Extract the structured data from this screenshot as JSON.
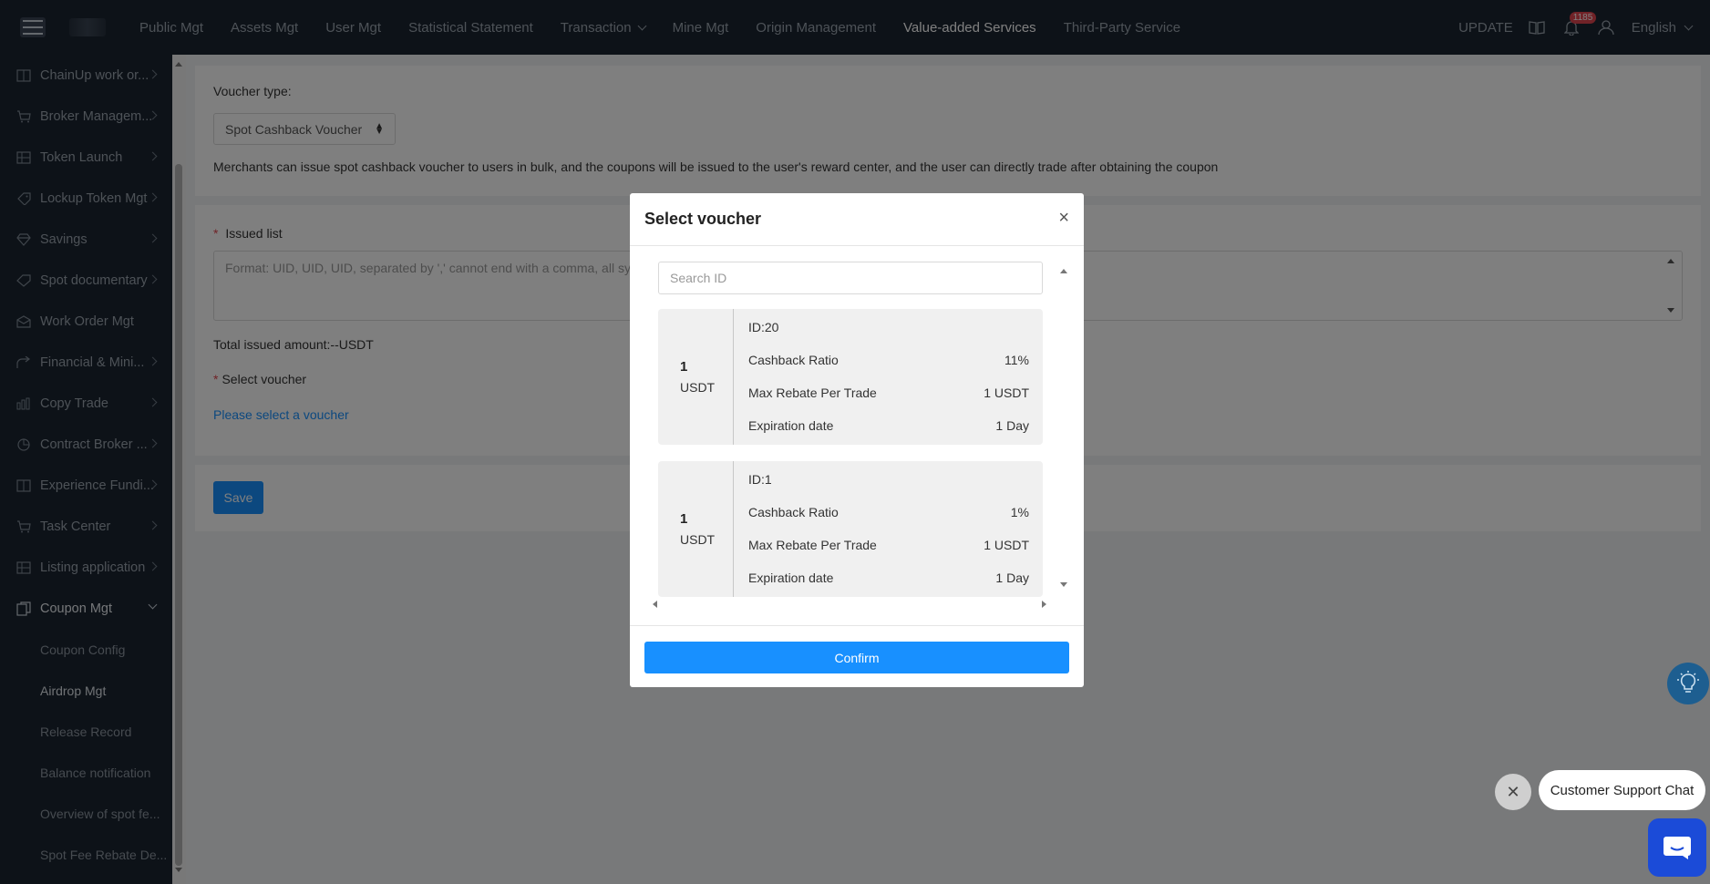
{
  "topbar": {
    "nav": [
      {
        "label": "Public Mgt"
      },
      {
        "label": "Assets Mgt"
      },
      {
        "label": "User Mgt"
      },
      {
        "label": "Statistical Statement"
      },
      {
        "label": "Transaction"
      },
      {
        "label": "Mine Mgt"
      },
      {
        "label": "Origin Management"
      },
      {
        "label": "Value-added Services"
      },
      {
        "label": "Third-Party Service"
      }
    ],
    "update_label": "UPDATE",
    "notification_count": "1185",
    "language": "English"
  },
  "sidebar": {
    "items": [
      {
        "label": "ChainUp work or...",
        "icon": "book-icon"
      },
      {
        "label": "Broker Managem...",
        "icon": "cart-icon"
      },
      {
        "label": "Token Launch",
        "icon": "grid-icon"
      },
      {
        "label": "Lockup Token Mgt",
        "icon": "lock-icon"
      },
      {
        "label": "Savings",
        "icon": "diamond-icon"
      },
      {
        "label": "Spot documentary",
        "icon": "tag-icon"
      },
      {
        "label": "Work Order Mgt",
        "icon": "envelope-icon"
      },
      {
        "label": "Financial & Mini...",
        "icon": "share-icon"
      },
      {
        "label": "Copy Trade",
        "icon": "bar-chart-icon"
      },
      {
        "label": "Contract Broker ...",
        "icon": "pie-icon"
      },
      {
        "label": "Experience Fundi...",
        "icon": "book-icon"
      },
      {
        "label": "Task Center",
        "icon": "cart-icon"
      },
      {
        "label": "Listing application",
        "icon": "grid-icon"
      },
      {
        "label": "Coupon Mgt",
        "icon": "coupon-icon"
      }
    ],
    "sub_items": [
      {
        "label": "Coupon Config"
      },
      {
        "label": "Airdrop Mgt"
      },
      {
        "label": "Release Record"
      },
      {
        "label": "Balance notification"
      },
      {
        "label": "Overview of spot fe..."
      },
      {
        "label": "Spot Fee Rebate De..."
      }
    ]
  },
  "form": {
    "voucher_type_label": "Voucher type:",
    "voucher_type_value": "Spot Cashback Voucher",
    "description": "Merchants can issue spot cashback voucher to users in bulk, and the coupons will be issued to the user's reward center, and the user can directly trade after obtaining the coupon",
    "issued_list_label": "Issued list",
    "issued_list_placeholder": "Format: UID, UID, UID, separated by ',' cannot end with a comma, all sym",
    "total_issued": "Total issued amount:--USDT",
    "select_voucher_label": "Select voucher",
    "select_voucher_link": "Please select a voucher",
    "save_label": "Save"
  },
  "modal": {
    "title": "Select voucher",
    "close_glyph": "×",
    "search_placeholder": "Search ID",
    "vouchers": [
      {
        "amount": "1",
        "currency": "USDT",
        "id": "ID:20",
        "ratio_label": "Cashback Ratio",
        "ratio": "11%",
        "max_label": "Max Rebate Per Trade",
        "max": "1 USDT",
        "exp_label": "Expiration date",
        "exp": "1 Day"
      },
      {
        "amount": "1",
        "currency": "USDT",
        "id": "ID:1",
        "ratio_label": "Cashback Ratio",
        "ratio": "1%",
        "max_label": "Max Rebate Per Trade",
        "max": "1 USDT",
        "exp_label": "Expiration date",
        "exp": "1 Day"
      }
    ],
    "confirm_label": "Confirm"
  },
  "chat": {
    "bubble_text": "Customer Support Chat",
    "close_glyph": "✕"
  },
  "colors": {
    "topbar_bg": "#1b2430",
    "primary": "#1890ff",
    "badge": "#e0454f"
  }
}
